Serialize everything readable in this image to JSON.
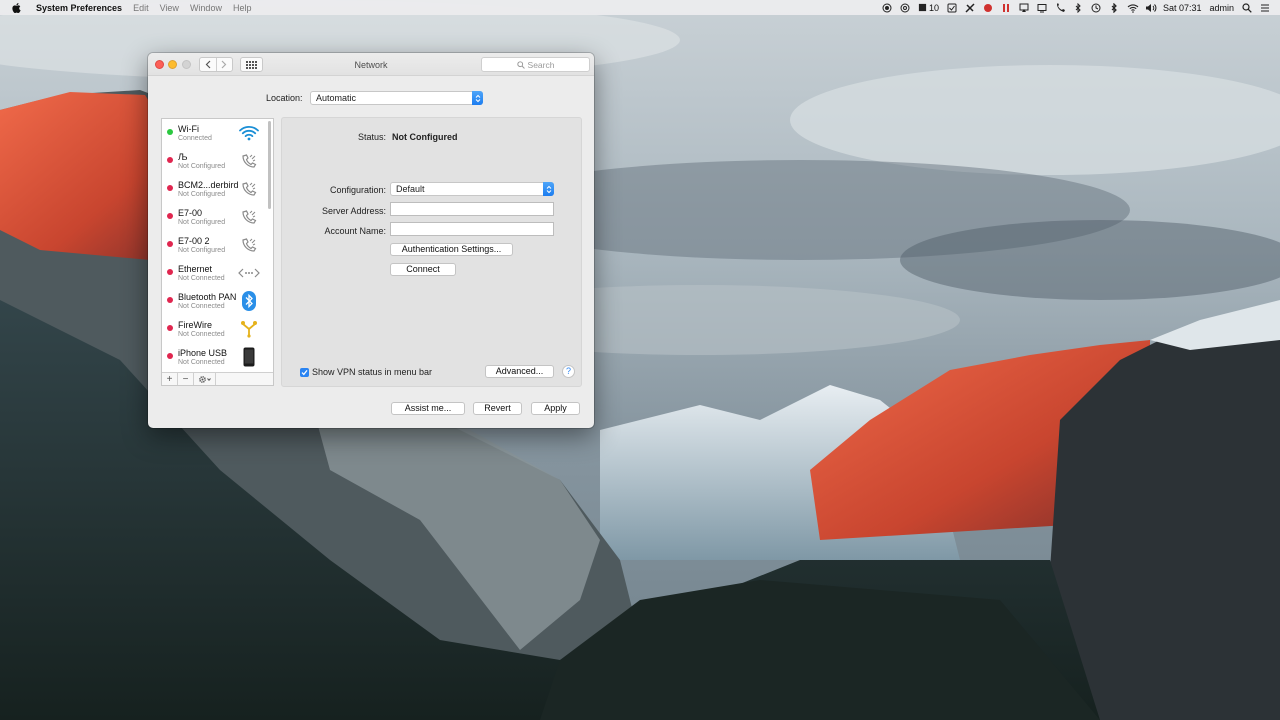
{
  "menubar": {
    "app_name": "System Preferences",
    "menus": [
      "Edit",
      "View",
      "Window",
      "Help"
    ],
    "status": {
      "badge_number": "10",
      "clock": "Sat 07:31",
      "user": "admin"
    }
  },
  "window": {
    "title": "Network",
    "search_placeholder": "Search",
    "location_label": "Location:",
    "location_value": "Automatic"
  },
  "services": [
    {
      "name": "Wi-Fi",
      "state": "Connected",
      "status_color": "#2bc840",
      "icon": "wifi-icon"
    },
    {
      "name": " Љ",
      "state": "Not Configured",
      "status_color": "#e0264f",
      "icon": "phone-icon"
    },
    {
      "name": "BCM2...derbird",
      "state": "Not Configured",
      "status_color": "#e0264f",
      "icon": "phone-icon"
    },
    {
      "name": "E7-00",
      "state": "Not Configured",
      "status_color": "#e0264f",
      "icon": "phone-icon"
    },
    {
      "name": "E7-00 2",
      "state": "Not Configured",
      "status_color": "#e0264f",
      "icon": "phone-icon"
    },
    {
      "name": "Ethernet",
      "state": "Not Connected",
      "status_color": "#e0264f",
      "icon": "ethernet-icon"
    },
    {
      "name": "Bluetooth PAN",
      "state": "Not Connected",
      "status_color": "#e0264f",
      "icon": "bluetooth-icon"
    },
    {
      "name": "FireWire",
      "state": "Not Connected",
      "status_color": "#e0264f",
      "icon": "firewire-icon"
    },
    {
      "name": "iPhone USB",
      "state": "Not Connected",
      "status_color": "#e0264f",
      "icon": "iphone-icon"
    }
  ],
  "list_toolbar": {
    "add": "+",
    "remove": "−"
  },
  "detail": {
    "status_label": "Status:",
    "status_value": "Not Configured",
    "configuration_label": "Configuration:",
    "configuration_value": "Default",
    "server_address_label": "Server Address:",
    "server_address_value": "",
    "account_name_label": "Account Name:",
    "account_name_value": "",
    "auth_button": "Authentication Settings...",
    "connect_button": "Connect",
    "show_vpn_label": "Show VPN status in menu bar",
    "show_vpn_checked": true,
    "advanced_button": "Advanced...",
    "help_button": "?"
  },
  "footer": {
    "assist_button": "Assist me...",
    "revert_button": "Revert",
    "apply_button": "Apply"
  },
  "colors": {
    "accent": "#2a84f2",
    "connected": "#2bc840",
    "disconnected": "#e0264f"
  }
}
